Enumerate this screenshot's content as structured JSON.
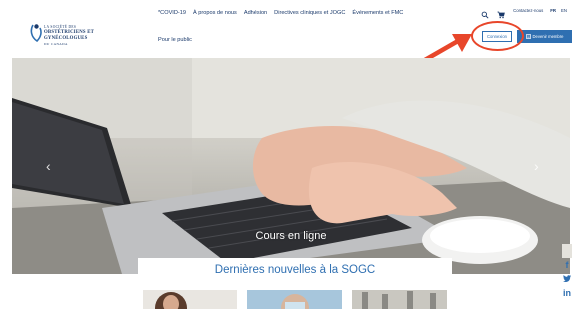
{
  "logo": {
    "line1": "LA SOCIÉTÉ DES",
    "line2": "OBSTÉTRICIENS ET",
    "line3": "GYNÉCOLOGUES",
    "line4": "DU CANADA"
  },
  "nav": {
    "items": [
      {
        "label": "*COVID-19"
      },
      {
        "label": "À propos de nous"
      },
      {
        "label": "Adhésion"
      },
      {
        "label": "Directives cliniques et JOGC"
      },
      {
        "label": "Événements et FMC"
      }
    ],
    "public_label": "Pour le public"
  },
  "utility": {
    "search_icon": "search-icon",
    "cart_icon": "cart-icon",
    "contact_label": "Contactez-nous",
    "lang_fr": "FR",
    "lang_en": "EN"
  },
  "buttons": {
    "connect_label": "Connexion",
    "member_label": "Devenir membre"
  },
  "hero": {
    "caption": "Cours en ligne",
    "prev_label": "‹",
    "next_label": "›"
  },
  "news": {
    "title": "Dernières nouvelles à la SOGC"
  },
  "social": {
    "facebook": "f",
    "twitter": "𝕥",
    "linkedin": "in"
  },
  "colors": {
    "brand_blue": "#2f6fb1",
    "nav_text": "#1b3a6b",
    "annotation_red": "#e8462a"
  }
}
